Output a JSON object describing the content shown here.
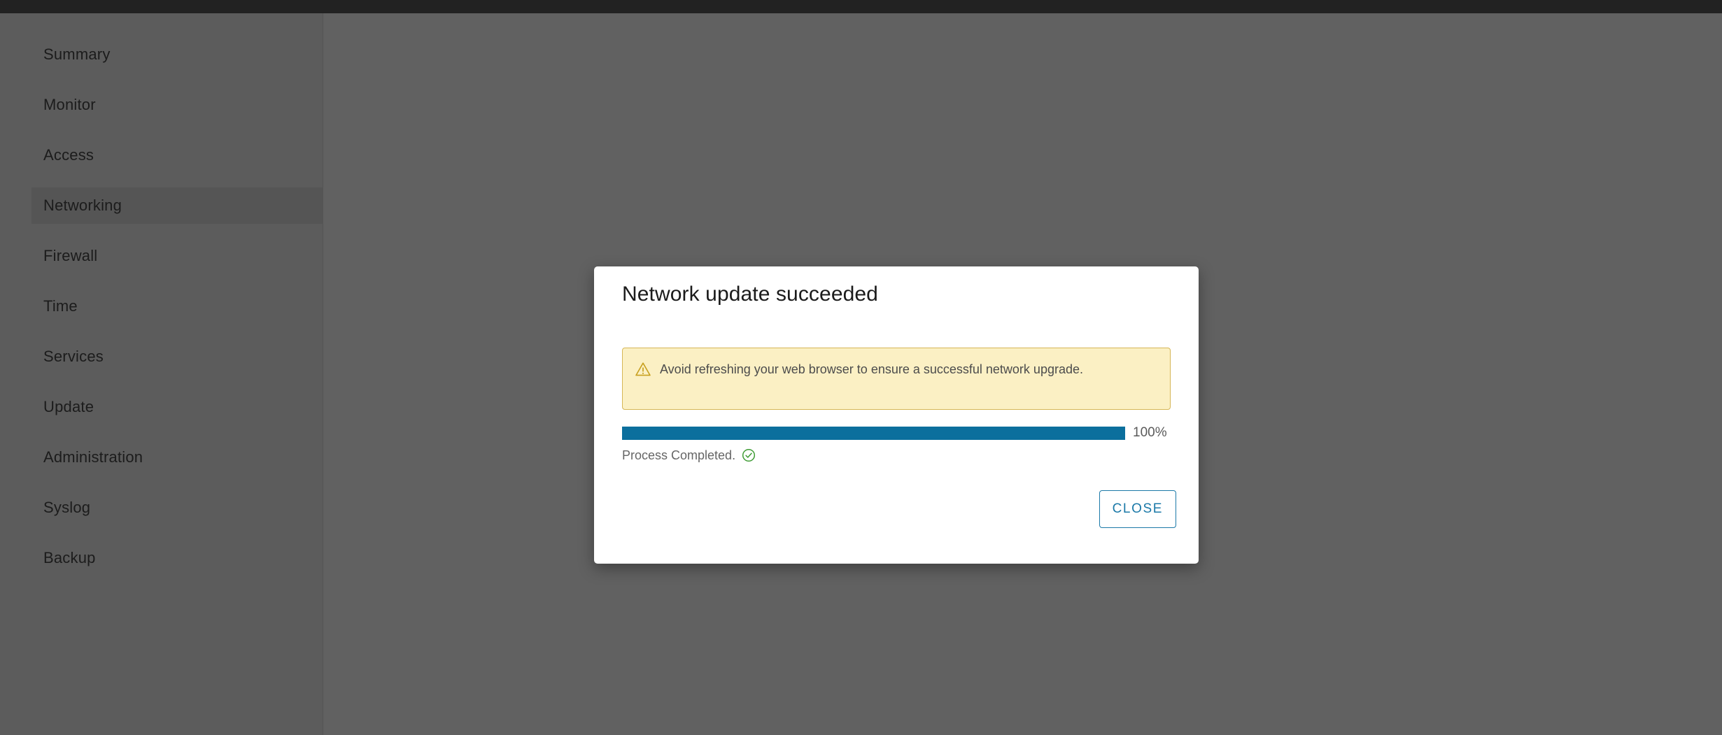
{
  "window": {
    "topbar_color": "#222222",
    "overlay_color": "rgba(0,0,0,0.62)"
  },
  "sidebar": {
    "items": [
      {
        "label": "Summary",
        "active": false
      },
      {
        "label": "Monitor",
        "active": false
      },
      {
        "label": "Access",
        "active": false
      },
      {
        "label": "Networking",
        "active": true
      },
      {
        "label": "Firewall",
        "active": false
      },
      {
        "label": "Time",
        "active": false
      },
      {
        "label": "Services",
        "active": false
      },
      {
        "label": "Update",
        "active": false
      },
      {
        "label": "Administration",
        "active": false
      },
      {
        "label": "Syslog",
        "active": false
      },
      {
        "label": "Backup",
        "active": false
      }
    ]
  },
  "dialog": {
    "title": "Network update succeeded",
    "alert": {
      "icon": "warning-triangle-icon",
      "message": "Avoid refreshing your web browser to ensure a successful network upgrade.",
      "background_color": "#fbf0c4",
      "border_color": "#d6b656",
      "icon_color": "#c8a020"
    },
    "progress": {
      "percent": 100,
      "percent_label": "100%",
      "fill_color": "#0b6f9d",
      "track_color": "#eeeeee"
    },
    "status": {
      "text": "Process Completed.",
      "icon": "check-circle-icon",
      "icon_color": "#3f9c35"
    },
    "close_button": {
      "label": "CLOSE",
      "color": "#1b79a8"
    }
  }
}
